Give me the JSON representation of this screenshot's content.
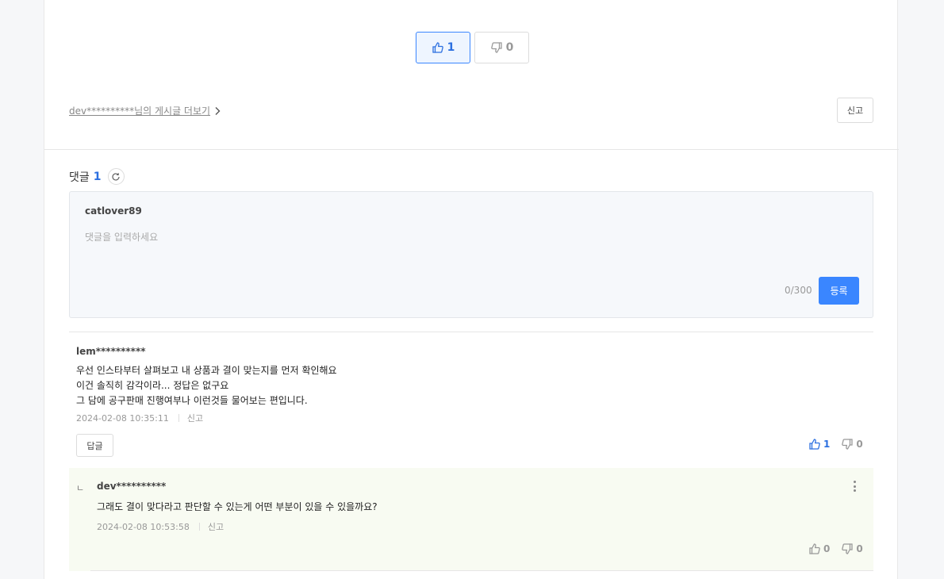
{
  "post": {
    "like_count": "1",
    "dislike_count": "0",
    "more_posts_label": "dev**********님의 게시글 더보기",
    "report_label": "신고"
  },
  "comments_section": {
    "title": "댓글",
    "count": "1"
  },
  "editor": {
    "username": "catlover89",
    "placeholder": "댓글을 입력하세요",
    "counter": "0/300",
    "submit_label": "등록"
  },
  "comment": {
    "author": "lem**********",
    "lines": [
      "우선 인스타부터 살펴보고 내 상품과 결이 맞는지를 먼저 확인해요",
      "이건 솔직히 감각이라... 정답은 없구요",
      "그 담에 공구판매 진행여부나 이런것들 물어보는 편입니다."
    ],
    "timestamp": "2024-02-08 10:35:11",
    "report_label": "신고",
    "reply_label": "답글",
    "like_count": "1",
    "dislike_count": "0"
  },
  "reply": {
    "corner": "ㄴ",
    "author": "dev**********",
    "body": "그래도 결이 맞다라고 판단할 수 있는게 어떤 부분이 있을 수 있을까요?",
    "timestamp": "2024-02-08 10:53:58",
    "report_label": "신고",
    "like_count": "0",
    "dislike_count": "0"
  },
  "colors": {
    "accent": "#3a86ff",
    "accent_text": "#2b6fe0",
    "reply_bg": "#f8fbf2"
  },
  "icons": {
    "like": "thumbs-up-icon",
    "dislike": "thumbs-down-icon",
    "refresh": "refresh-icon",
    "chevron": "chevron-right-icon",
    "more": "kebab-menu-icon"
  }
}
